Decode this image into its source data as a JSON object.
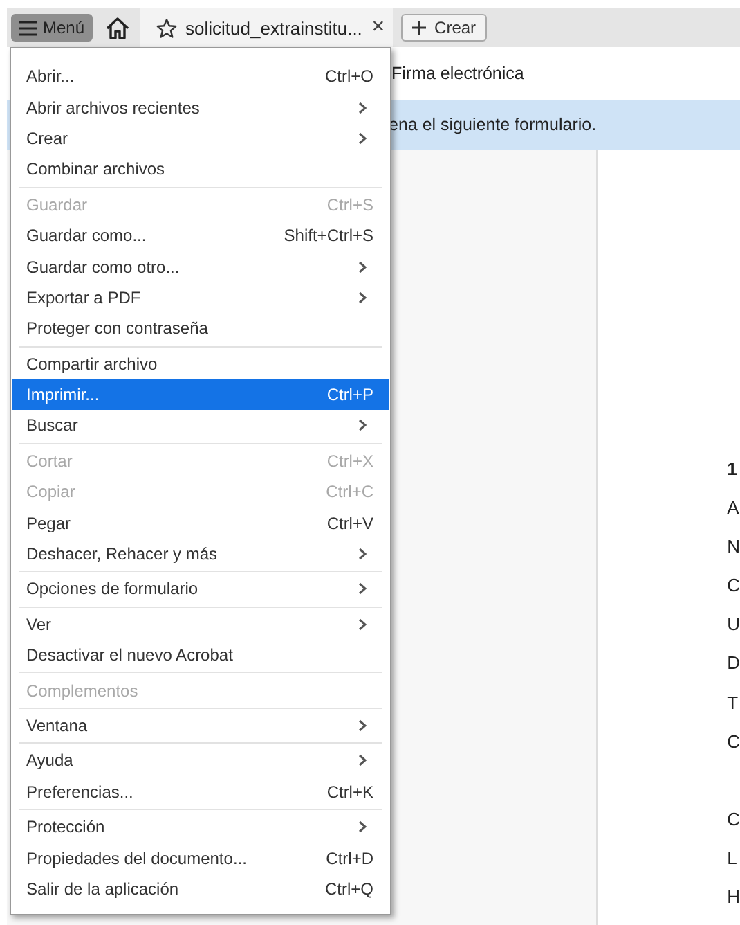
{
  "toolbar": {
    "menu_button": "Menú",
    "tab": {
      "title": "solicitud_extrainstitu...",
      "close": "×"
    },
    "create_button": "Crear"
  },
  "subtoolbar": {
    "label": "Firma electrónica"
  },
  "banner": {
    "text": "ena el siguiente formulario."
  },
  "document": {
    "lines": [
      {
        "text": "1",
        "bold": true
      },
      {
        "text": "A",
        "bold": false
      },
      {
        "text": "N",
        "bold": false
      },
      {
        "text": "C",
        "bold": false
      },
      {
        "text": "U",
        "bold": false
      },
      {
        "text": "D",
        "bold": false
      },
      {
        "text": "T",
        "bold": false
      },
      {
        "text": "C",
        "bold": false
      },
      {
        "text": "C",
        "bold": false,
        "gap": true
      },
      {
        "text": "L",
        "bold": false
      },
      {
        "text": "H",
        "bold": false
      }
    ]
  },
  "menu": {
    "groups": [
      {
        "items": [
          {
            "label": "Abrir...",
            "shortcut": "Ctrl+O",
            "submenu": false,
            "disabled": false,
            "selected": false
          },
          {
            "label": "Abrir archivos recientes",
            "submenu": true,
            "disabled": false,
            "selected": false
          },
          {
            "label": "Crear",
            "submenu": true,
            "disabled": false,
            "selected": false
          },
          {
            "label": "Combinar archivos",
            "submenu": false,
            "disabled": false,
            "selected": false
          }
        ]
      },
      {
        "items": [
          {
            "label": "Guardar",
            "shortcut": "Ctrl+S",
            "submenu": false,
            "disabled": true,
            "selected": false
          },
          {
            "label": "Guardar como...",
            "shortcut": "Shift+Ctrl+S",
            "submenu": false,
            "disabled": false,
            "selected": false
          },
          {
            "label": "Guardar como otro...",
            "submenu": true,
            "disabled": false,
            "selected": false
          },
          {
            "label": "Exportar a PDF",
            "submenu": true,
            "disabled": false,
            "selected": false
          },
          {
            "label": "Proteger con contraseña",
            "submenu": false,
            "disabled": false,
            "selected": false
          }
        ]
      },
      {
        "items": [
          {
            "label": "Compartir archivo",
            "submenu": false,
            "disabled": false,
            "selected": false
          },
          {
            "label": "Imprimir...",
            "shortcut": "Ctrl+P",
            "submenu": false,
            "disabled": false,
            "selected": true
          },
          {
            "label": "Buscar",
            "submenu": true,
            "disabled": false,
            "selected": false
          }
        ]
      },
      {
        "items": [
          {
            "label": "Cortar",
            "shortcut": "Ctrl+X",
            "submenu": false,
            "disabled": true,
            "selected": false
          },
          {
            "label": "Copiar",
            "shortcut": "Ctrl+C",
            "submenu": false,
            "disabled": true,
            "selected": false
          },
          {
            "label": "Pegar",
            "shortcut": "Ctrl+V",
            "submenu": false,
            "disabled": false,
            "selected": false
          },
          {
            "label": "Deshacer, Rehacer y más",
            "submenu": true,
            "disabled": false,
            "selected": false
          }
        ]
      },
      {
        "items": [
          {
            "label": "Opciones de formulario",
            "submenu": true,
            "disabled": false,
            "selected": false
          }
        ]
      },
      {
        "items": [
          {
            "label": "Ver",
            "submenu": true,
            "disabled": false,
            "selected": false
          },
          {
            "label": "Desactivar el nuevo Acrobat",
            "submenu": false,
            "disabled": false,
            "selected": false
          }
        ]
      },
      {
        "items": [
          {
            "label": "Complementos",
            "submenu": false,
            "disabled": true,
            "selected": false
          }
        ]
      },
      {
        "items": [
          {
            "label": "Ventana",
            "submenu": true,
            "disabled": false,
            "selected": false
          }
        ]
      },
      {
        "items": [
          {
            "label": "Ayuda",
            "submenu": true,
            "disabled": false,
            "selected": false
          },
          {
            "label": "Preferencias...",
            "shortcut": "Ctrl+K",
            "submenu": false,
            "disabled": false,
            "selected": false
          }
        ]
      },
      {
        "items": [
          {
            "label": "Protección",
            "submenu": true,
            "disabled": false,
            "selected": false
          },
          {
            "label": "Propiedades del documento...",
            "shortcut": "Ctrl+D",
            "submenu": false,
            "disabled": false,
            "selected": false
          },
          {
            "label": "Salir de la aplicación",
            "shortcut": "Ctrl+Q",
            "submenu": false,
            "disabled": false,
            "selected": false
          }
        ]
      }
    ]
  }
}
